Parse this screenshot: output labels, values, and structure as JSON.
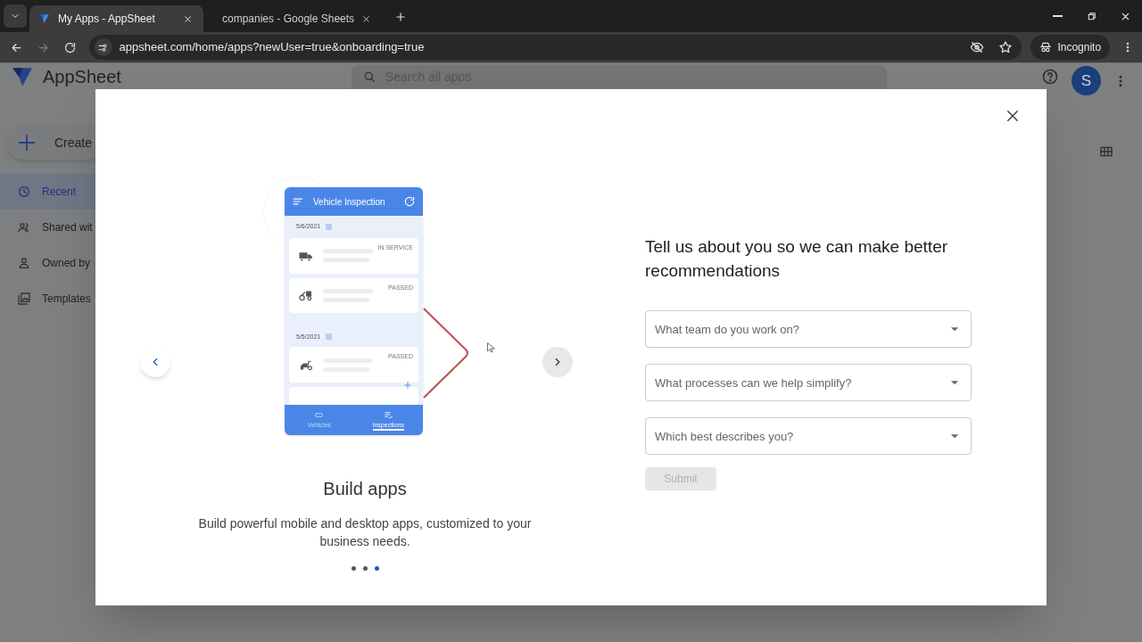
{
  "browser": {
    "tabs": [
      {
        "title": "My Apps - AppSheet",
        "selected": true
      },
      {
        "title": "companies - Google Sheets",
        "selected": false
      }
    ],
    "url": "appsheet.com/home/apps?newUser=true&onboarding=true",
    "profile": "Incognito"
  },
  "app": {
    "logo": "AppSheet",
    "search": {
      "placeholder": "Search all apps"
    },
    "avatar": "S",
    "create": "Create",
    "nav": [
      {
        "label": "Recent",
        "selected": true
      },
      {
        "label": "Shared wit",
        "selected": false
      },
      {
        "label": "Owned by",
        "selected": false
      },
      {
        "label": "Templates",
        "selected": false
      }
    ]
  },
  "modal": {
    "slide": {
      "mockup": {
        "title": "Vehicle Inspection",
        "groups": [
          {
            "date": "5/6/2021",
            "items": [
              {
                "kind": "truck",
                "status": "IN SERVICE"
              },
              {
                "kind": "tractor",
                "status": "PASSED"
              }
            ]
          },
          {
            "date": "5/5/2021",
            "items": [
              {
                "kind": "scooter",
                "status": "PASSED"
              }
            ]
          }
        ],
        "tabs": [
          {
            "label": "Vehicles",
            "selected": false
          },
          {
            "label": "Inspections",
            "selected": true
          }
        ]
      },
      "title": "Build apps",
      "description": "Build powerful mobile and desktop apps, customized to your business needs."
    },
    "dots": [
      {
        "selected": false
      },
      {
        "selected": false
      },
      {
        "selected": true
      }
    ],
    "form": {
      "heading": "Tell us about you so we can make better recommendations",
      "dropdowns": [
        {
          "placeholder": "What team do you work on?"
        },
        {
          "placeholder": "What processes can we help simplify?"
        },
        {
          "placeholder": "Which best describes you?"
        }
      ],
      "submit": {
        "label": "Submit",
        "disabled": true
      }
    }
  }
}
